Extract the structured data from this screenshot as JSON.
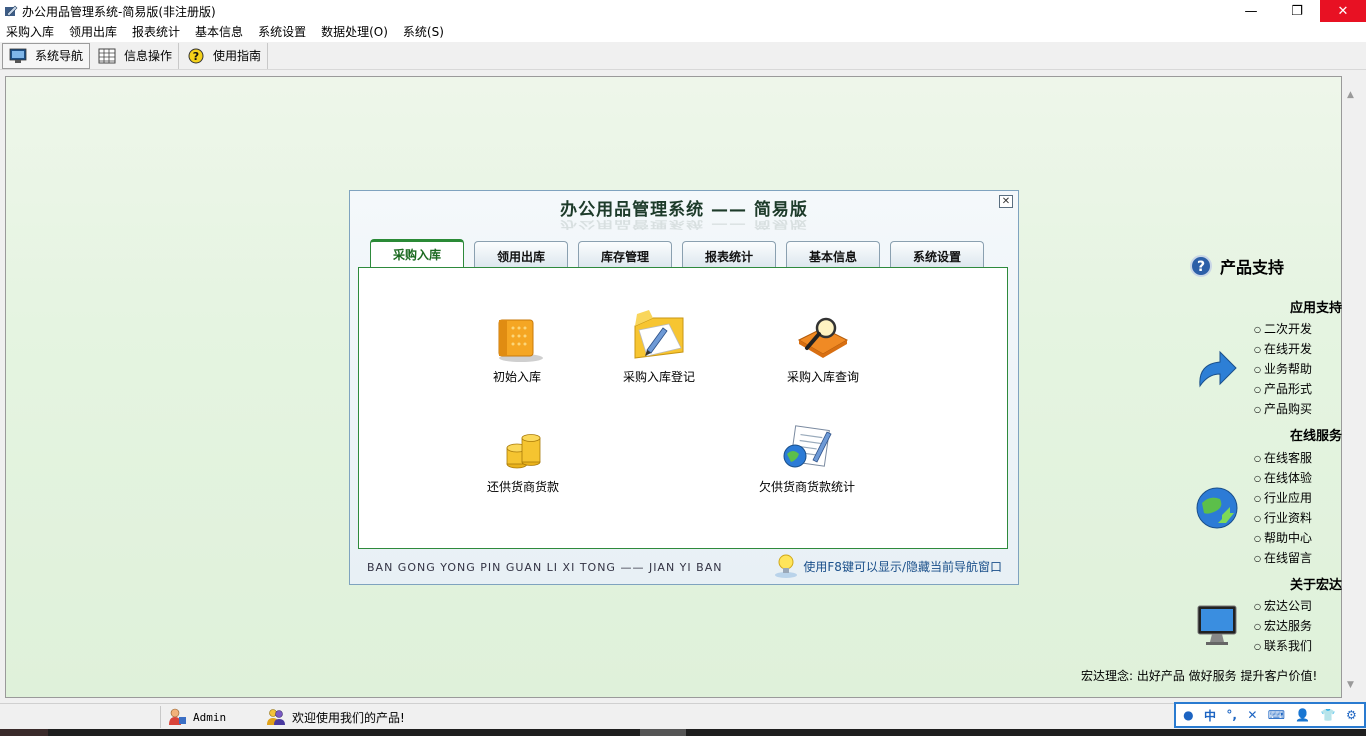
{
  "window": {
    "title": "办公用品管理系统-简易版(非注册版)",
    "minimize": "—",
    "maximize": "❐",
    "close": "✕"
  },
  "menubar": {
    "items": [
      "采购入库",
      "领用出库",
      "报表统计",
      "基本信息",
      "系统设置",
      "数据处理(O)",
      "系统(S)"
    ]
  },
  "toolbar": {
    "items": [
      {
        "label": "系统导航",
        "icon": "monitor-icon",
        "active": true
      },
      {
        "label": "信息操作",
        "icon": "grid-icon",
        "active": false
      },
      {
        "label": "使用指南",
        "icon": "help-icon",
        "active": false
      }
    ]
  },
  "dialog": {
    "title": "办公用品管理系统 —— 简易版",
    "close": "✕",
    "tabs": [
      "采购入库",
      "领用出库",
      "库存管理",
      "报表统计",
      "基本信息",
      "系统设置"
    ],
    "active_tab": 0,
    "functions": [
      {
        "label": "初始入库",
        "icon": "book-stack-icon"
      },
      {
        "label": "采购入库登记",
        "icon": "folder-pen-icon"
      },
      {
        "label": "采购入库查询",
        "icon": "magnifier-book-icon"
      },
      {
        "label": "还供货商货款",
        "icon": "coins-icon"
      },
      {
        "label": "欠供货商货款统计",
        "icon": "report-globe-icon"
      }
    ],
    "footer_pinyin": "BAN GONG YONG PIN GUAN LI XI TONG —— JIAN YI BAN",
    "footer_hint": "使用F8键可以显示/隐藏当前导航窗口"
  },
  "support": {
    "title": "产品支持",
    "sections": [
      {
        "title": "应用支持",
        "icon": "arrow-icon",
        "items": [
          "二次开发",
          "在线开发",
          "业务帮助",
          "产品形式",
          "产品购买"
        ]
      },
      {
        "title": "在线服务",
        "icon": "globe-icon",
        "items": [
          "在线客服",
          "在线体验",
          "行业应用",
          "行业资料",
          "帮助中心",
          "在线留言"
        ]
      },
      {
        "title": "关于宏达",
        "icon": "monitor-screen-icon",
        "items": [
          "宏达公司",
          "宏达服务",
          "联系我们"
        ]
      }
    ],
    "motto": "宏达理念: 出好产品 做好服务 提升客户价值!"
  },
  "statusbar": {
    "user": "Admin",
    "welcome": "欢迎使用我们的产品!"
  },
  "ime": {
    "lang": "中",
    "items": [
      "°,",
      "✕",
      "⌨",
      "👤",
      "👕",
      "⚙"
    ]
  },
  "colors": {
    "accent_green": "#2a8a36",
    "close_red": "#e81123",
    "hint_blue": "#1a4f8a",
    "ime_blue": "#2a7bd0"
  }
}
